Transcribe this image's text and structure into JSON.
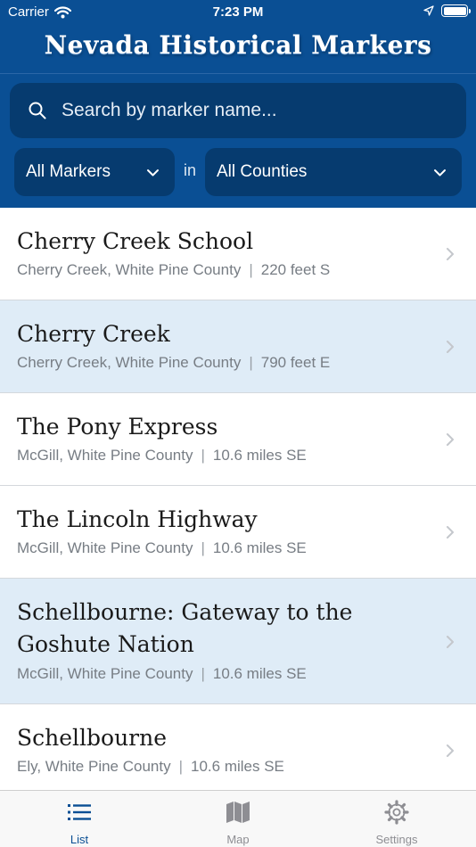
{
  "status_bar": {
    "carrier": "Carrier",
    "time": "7:23 PM",
    "icons": [
      "wifi-icon",
      "location-arrow-icon",
      "battery-icon"
    ]
  },
  "header": {
    "title": "Nevada Historical Markers",
    "background_color": "#0a4f94"
  },
  "search": {
    "placeholder": "Search by marker name...",
    "value": "",
    "icon": "search-icon"
  },
  "filters": {
    "type_selected": "All Markers",
    "joiner": "in",
    "county_selected": "All Counties",
    "icon": "chevron-down-icon"
  },
  "markers": [
    {
      "name": "Cherry Creek School",
      "location": "Cherry Creek, White Pine County",
      "distance": "220 feet S",
      "highlighted": false
    },
    {
      "name": "Cherry Creek",
      "location": "Cherry Creek, White Pine County",
      "distance": "790 feet E",
      "highlighted": true
    },
    {
      "name": "The Pony Express",
      "location": "McGill, White Pine County",
      "distance": "10.6 miles SE",
      "highlighted": false
    },
    {
      "name": "The Lincoln Highway",
      "location": "McGill, White Pine County",
      "distance": "10.6 miles SE",
      "highlighted": false
    },
    {
      "name": "Schellbourne: Gateway to the Goshute Nation",
      "location": "McGill, White Pine County",
      "distance": "10.6 miles SE",
      "highlighted": true
    },
    {
      "name": "Schellbourne",
      "location": "Ely, White Pine County",
      "distance": "10.6 miles SE",
      "highlighted": false
    }
  ],
  "meta_separator": "|",
  "tabs": [
    {
      "label": "List",
      "icon": "list-icon",
      "active": true
    },
    {
      "label": "Map",
      "icon": "map-icon",
      "active": false
    },
    {
      "label": "Settings",
      "icon": "gear-icon",
      "active": false
    }
  ],
  "colors": {
    "accent": "#0a4f94",
    "control_background": "#063b6f",
    "highlight_row": "#dfecf7",
    "inactive_tab": "#8e8e93"
  }
}
